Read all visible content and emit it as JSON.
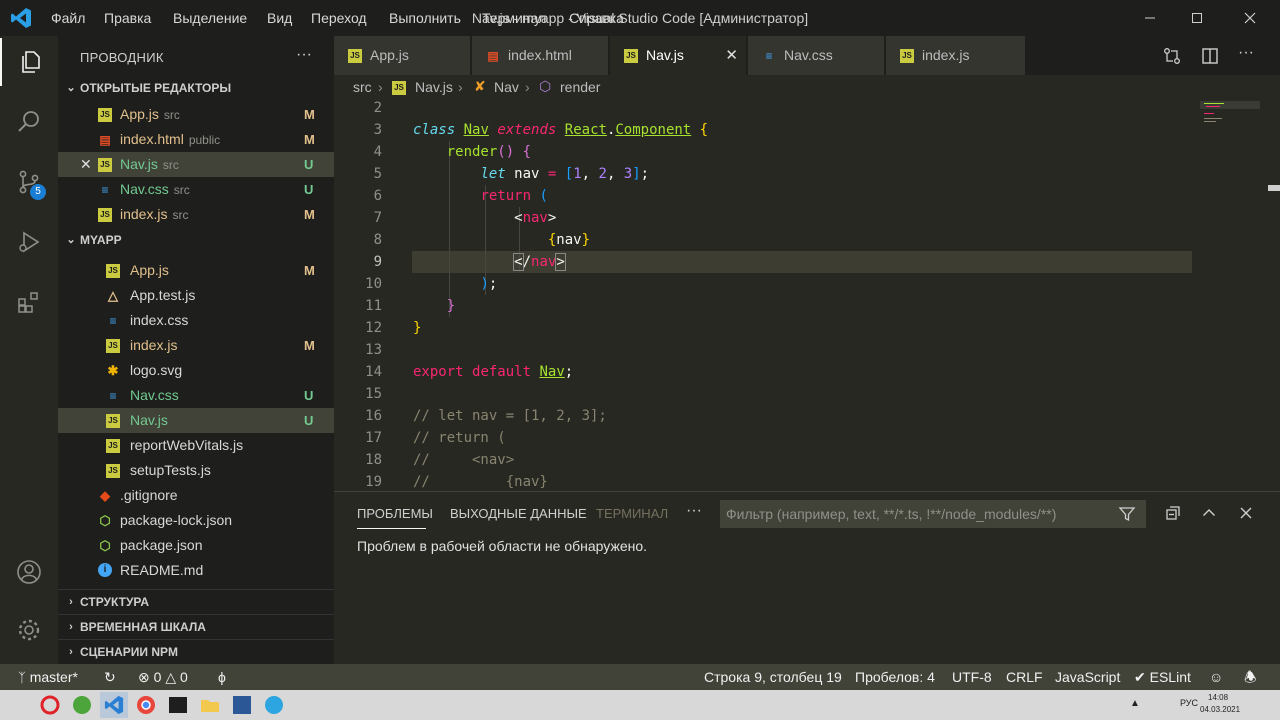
{
  "titlebar": {
    "menu": [
      "Файл",
      "Правка",
      "Выделение",
      "Вид",
      "Переход",
      "Выполнить",
      "Терминал",
      "Справка"
    ],
    "title": "Nav.js - myapp - Visual Studio Code [Администратор]"
  },
  "activity": {
    "scm_badge": "5"
  },
  "sidebar": {
    "title": "ПРОВОДНИК",
    "more": "···",
    "open_editors_header": "ОТКРЫТЫЕ РЕДАКТОРЫ",
    "open_editors": [
      {
        "name": "App.js",
        "dir": "src",
        "badge": "M",
        "icon": "js-icon"
      },
      {
        "name": "index.html",
        "dir": "public",
        "badge": "M",
        "icon": "html-icon"
      },
      {
        "name": "Nav.js",
        "dir": "src",
        "badge": "U",
        "icon": "js-icon"
      },
      {
        "name": "Nav.css",
        "dir": "src",
        "badge": "U",
        "icon": "css-icon"
      },
      {
        "name": "index.js",
        "dir": "src",
        "badge": "M",
        "icon": "js-icon"
      }
    ],
    "project_header": "MYAPP",
    "files": [
      {
        "name": "App.js",
        "badge": "M",
        "icon": "js-icon"
      },
      {
        "name": "App.test.js",
        "badge": "",
        "icon": "test-icon"
      },
      {
        "name": "index.css",
        "badge": "",
        "icon": "css-icon"
      },
      {
        "name": "index.js",
        "badge": "M",
        "icon": "js-icon"
      },
      {
        "name": "logo.svg",
        "badge": "",
        "icon": "svg-icon"
      },
      {
        "name": "Nav.css",
        "badge": "U",
        "icon": "css-icon"
      },
      {
        "name": "Nav.js",
        "badge": "U",
        "icon": "js-icon"
      },
      {
        "name": "reportWebVitals.js",
        "badge": "",
        "icon": "js-icon"
      },
      {
        "name": "setupTests.js",
        "badge": "",
        "icon": "js-icon"
      },
      {
        "name": ".gitignore",
        "badge": "",
        "icon": "git-icon"
      },
      {
        "name": "package-lock.json",
        "badge": "",
        "icon": "npm-icon"
      },
      {
        "name": "package.json",
        "badge": "",
        "icon": "npm-icon"
      },
      {
        "name": "README.md",
        "badge": "",
        "icon": "info-icon"
      }
    ],
    "outline": "СТРУКТУРА",
    "timeline": "ВРЕМЕННАЯ ШКАЛА",
    "npm_scripts": "СЦЕНАРИИ NPM"
  },
  "tabs": [
    {
      "label": "App.js",
      "icon": "js-icon"
    },
    {
      "label": "index.html",
      "icon": "html-icon"
    },
    {
      "label": "Nav.js",
      "icon": "js-icon"
    },
    {
      "label": "Nav.css",
      "icon": "css-icon"
    },
    {
      "label": "index.js",
      "icon": "js-icon"
    }
  ],
  "breadcrumb": {
    "folder": "src",
    "file": "Nav.js",
    "class": "Nav",
    "method": "render"
  },
  "editor": {
    "line_numbers": [
      "2",
      "3",
      "4",
      "5",
      "6",
      "7",
      "8",
      "9",
      "10",
      "11",
      "12",
      "13",
      "14",
      "15",
      "16",
      "17",
      "18",
      "19"
    ],
    "comments": [
      "// let nav = [1, 2, 3];",
      "// return (",
      "//     <nav>",
      "//         {nav}"
    ]
  },
  "panel": {
    "tabs": [
      "ПРОБЛЕМЫ",
      "ВЫХОДНЫЕ ДАННЫЕ",
      "ТЕРМИНАЛ"
    ],
    "more": "···",
    "filter_placeholder": "Фильтр (например, text, **/*.ts, !**/node_modules/**)",
    "message": "Проблем в рабочей области не обнаружено."
  },
  "status": {
    "branch": "master*",
    "errors": "0",
    "warnings": "0",
    "position": "Строка 9, столбец 19",
    "spaces": "Пробелов: 4",
    "encoding": "UTF-8",
    "eol": "CRLF",
    "language": "JavaScript",
    "linter": "ESLint"
  },
  "taskbar": {
    "lang": "РУС",
    "time": "14:08",
    "date": "04.03.2021"
  },
  "colors": {
    "editor_bg": "#272822",
    "sidebar_bg": "#1e1f1c",
    "status_bg": "#414339",
    "modified": "#e2c08d",
    "untracked": "#73c991",
    "keyword": "#f92672",
    "function": "#a6e22e"
  }
}
